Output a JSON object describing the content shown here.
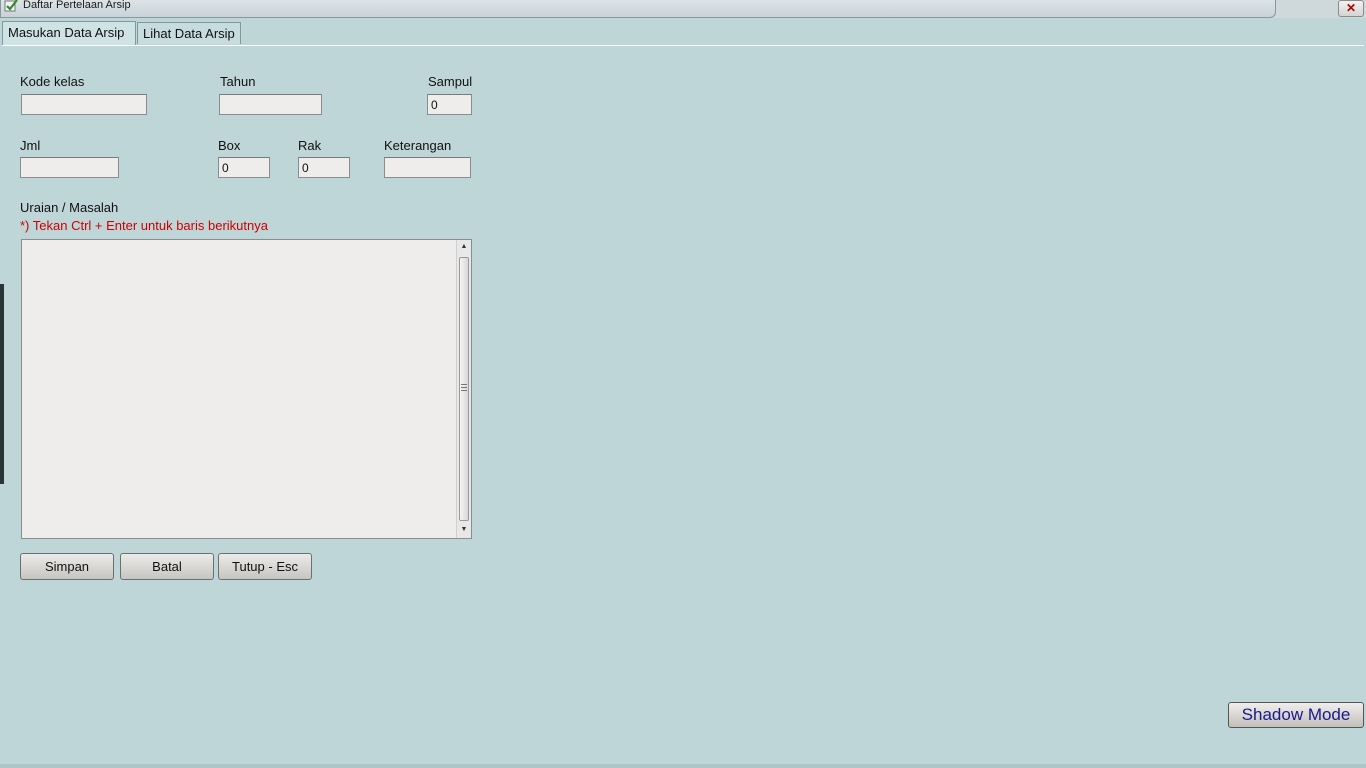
{
  "window": {
    "title": "Daftar Pertelaan Arsip",
    "close_label": "✕"
  },
  "tabs": [
    {
      "label": "Masukan Data Arsip",
      "active": true
    },
    {
      "label": "Lihat Data Arsip",
      "active": false
    }
  ],
  "form": {
    "kode_kelas": {
      "label": "Kode kelas",
      "value": ""
    },
    "tahun": {
      "label": "Tahun",
      "value": ""
    },
    "sampul": {
      "label": "Sampul",
      "value": "0"
    },
    "jml": {
      "label": "Jml",
      "value": ""
    },
    "box": {
      "label": "Box",
      "value": "0"
    },
    "rak": {
      "label": "Rak",
      "value": "0"
    },
    "keterangan": {
      "label": "Keterangan",
      "value": ""
    },
    "uraian": {
      "label": "Uraian / Masalah",
      "hint": "*) Tekan Ctrl + Enter untuk baris berikutnya",
      "value": ""
    }
  },
  "buttons": {
    "simpan": "Simpan",
    "batal": "Batal",
    "tutup": "Tutup - Esc",
    "shadow_mode": "Shadow Mode"
  },
  "icons": {
    "app": "checkmark-app-icon",
    "close": "close-icon",
    "scroll_up": "arrow-up-icon",
    "scroll_down": "arrow-down-icon"
  },
  "colors": {
    "background": "#bfd6d8",
    "hint": "#cc0000",
    "shadow_mode_text": "#1a1a8a"
  }
}
